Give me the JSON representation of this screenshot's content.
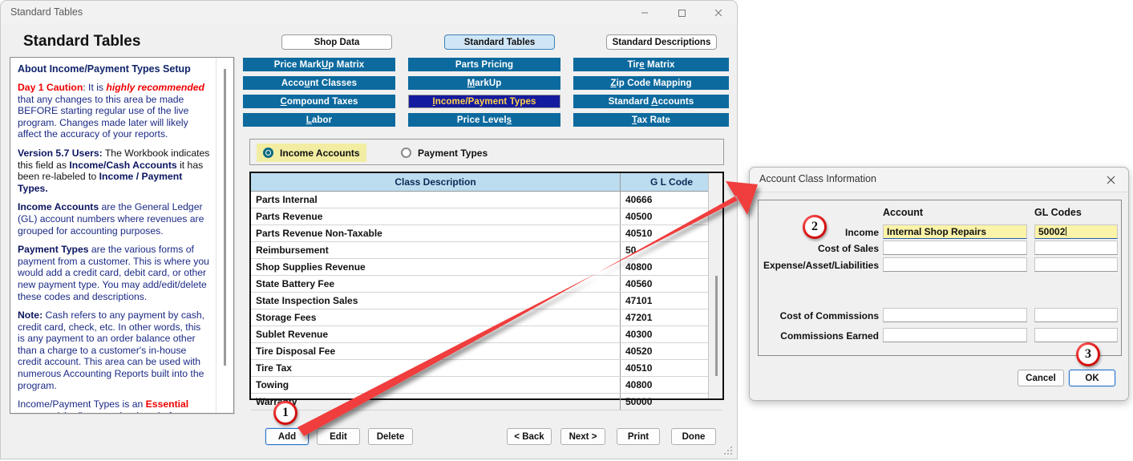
{
  "window": {
    "title": "Standard Tables",
    "page_title": "Standard Tables",
    "controls": {
      "minimize": "minimize-icon",
      "maximize": "maximize-icon",
      "close": "close-icon"
    }
  },
  "tabs": [
    {
      "label": "Shop Data",
      "active": false
    },
    {
      "label": "Standard Tables",
      "active": true
    },
    {
      "label": "Standard Descriptions",
      "active": false
    }
  ],
  "nav_buttons": {
    "column1": [
      "Price MarkUp Matrix",
      "Account Classes",
      "Compound Taxes",
      "Labor"
    ],
    "column2": [
      "Parts Pricing",
      "MarkUp",
      "Income/Payment Types",
      "Price Levels"
    ],
    "column3": [
      "Tire Matrix",
      "Zip Code Mapping",
      "Standard Accounts",
      "Tax Rate"
    ],
    "selected": "Income/Payment Types",
    "colors": {
      "normal_bg": "#0d6a9e",
      "selected_bg": "#141b9e",
      "selected_text": "#ffd24a"
    }
  },
  "radio_group": {
    "options": [
      {
        "label": "Income Accounts",
        "selected": true
      },
      {
        "label": "Payment Types",
        "selected": false
      }
    ],
    "highlight_color": "#f2eda2"
  },
  "table": {
    "columns": [
      "Class Description",
      "G L Code"
    ],
    "header_bg": "#bcdcf0",
    "rows": [
      {
        "description": "Parts Internal",
        "gl_code": "40666"
      },
      {
        "description": "Parts Revenue",
        "gl_code": "40500"
      },
      {
        "description": "Parts Revenue Non-Taxable",
        "gl_code": "40510"
      },
      {
        "description": "Reimbursement",
        "gl_code": "50"
      },
      {
        "description": "Shop Supplies Revenue",
        "gl_code": "40800"
      },
      {
        "description": "State Battery Fee",
        "gl_code": "40560"
      },
      {
        "description": "State Inspection Sales",
        "gl_code": "47101"
      },
      {
        "description": "Storage Fees",
        "gl_code": "47201"
      },
      {
        "description": "Sublet Revenue",
        "gl_code": "40300"
      },
      {
        "description": "Tire Disposal Fee",
        "gl_code": "40520"
      },
      {
        "description": "Tire Tax",
        "gl_code": "40510"
      },
      {
        "description": "Towing",
        "gl_code": "40800"
      },
      {
        "description": "Warranty",
        "gl_code": "50000"
      }
    ]
  },
  "bottom_buttons": [
    {
      "id": "add",
      "label": "Add",
      "focused": true
    },
    {
      "id": "edit",
      "label": "Edit",
      "focused": false
    },
    {
      "id": "delete",
      "label": "Delete",
      "focused": false
    },
    {
      "id": "back",
      "label": "< Back",
      "focused": false
    },
    {
      "id": "next",
      "label": "Next >",
      "focused": false
    },
    {
      "id": "print",
      "label": "Print",
      "focused": false
    },
    {
      "id": "done",
      "label": "Done",
      "focused": false
    }
  ],
  "info_panel": {
    "heading": "About Income/Payment Types Setup",
    "paragraphs": [
      {
        "lead": "Day 1 Caution",
        "lead_style": "red",
        "text": ": It is ",
        "emphasis": "highly recommended",
        "tail": " that any changes to this area be made BEFORE starting regular use of the live program. Changes made later will likely affect the accuracy of your reports."
      },
      {
        "lead": "Version 5.7 Users:",
        "text": " The Workbook indicates this field as Income/Cash Accounts it has been re-labeled to Income / Payment Types."
      },
      {
        "lead": "Income Accounts",
        "text": " are the General Ledger (GL) account numbers where revenues are grouped for accounting purposes."
      },
      {
        "lead": "Payment Types",
        "text": " are the various forms of payment from a customer. This is where you would add a credit card, debit card, or other new payment type. You may add/edit/delete these codes and descriptions."
      },
      {
        "lead": "Note:",
        "text": " Cash refers to any payment by cash, credit card, check, etc. In other words, this is any payment to an order balance other than a charge to a customer's in-house credit account. This area can be used with numerous Accounting Reports built into the program."
      },
      {
        "lead": "",
        "text": "Income/Payment Types is an Essential setup activity (i.e. must be done before entering"
      }
    ]
  },
  "dialog": {
    "title": "Account Class Information",
    "close_icon": "close-icon",
    "column_headers": {
      "account": "Account",
      "gl_codes": "GL Codes"
    },
    "fields": [
      {
        "label": "Income",
        "account": "Internal Shop Repairs",
        "gl_code": "50002",
        "highlighted": true
      },
      {
        "label": "Cost of Sales",
        "account": "",
        "gl_code": "",
        "highlighted": false
      },
      {
        "label": "Expense/Asset/Liabilities",
        "account": "",
        "gl_code": "",
        "highlighted": false
      },
      {
        "label": "Cost of Commissions",
        "account": "",
        "gl_code": "",
        "highlighted": false
      },
      {
        "label": "Commissions Earned",
        "account": "",
        "gl_code": "",
        "highlighted": false
      }
    ],
    "buttons": [
      {
        "id": "cancel",
        "label": "Cancel",
        "focused": false
      },
      {
        "id": "ok",
        "label": "OK",
        "focused": true
      }
    ]
  },
  "annotations": {
    "badges": [
      {
        "number": "1",
        "target": "add-button"
      },
      {
        "number": "2",
        "target": "income-field"
      },
      {
        "number": "3",
        "target": "ok-button"
      }
    ],
    "arrow_color": "#f03c3c"
  }
}
